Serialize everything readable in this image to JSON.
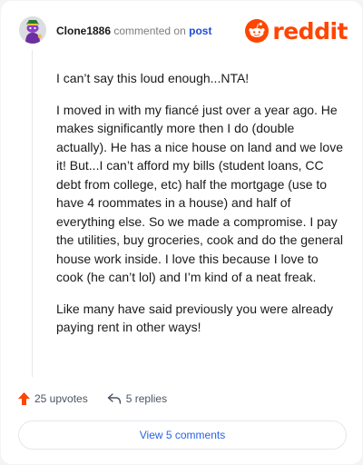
{
  "comment": {
    "username": "Clone1886",
    "verb": "commented on",
    "target": "post",
    "brand": "reddit",
    "paragraphs": [
      "I can’t say this loud enough...NTA!",
      "I moved in with my fiancé just over a year ago. He makes significantly more then I do (double actually). He has a nice house on land and we love it! But...I can’t afford my bills (student loans, CC debt from college, etc) half the mortgage (use to have 4 roommates in a house) and half of everything else. So we made a compromise. I pay the utilities, buy groceries, cook and do the general house work inside. I love this because I love to cook (he can’t lol) and I’m kind of a neat freak.",
      "Like many have said previously you were already paying rent in other ways!"
    ]
  },
  "actions": {
    "upvotes": "25 upvotes",
    "replies": "5 replies",
    "view_comments": "View 5 comments"
  },
  "colors": {
    "brand": "#ff4500",
    "link": "#1d4ed8",
    "button_text": "#2563eb"
  }
}
